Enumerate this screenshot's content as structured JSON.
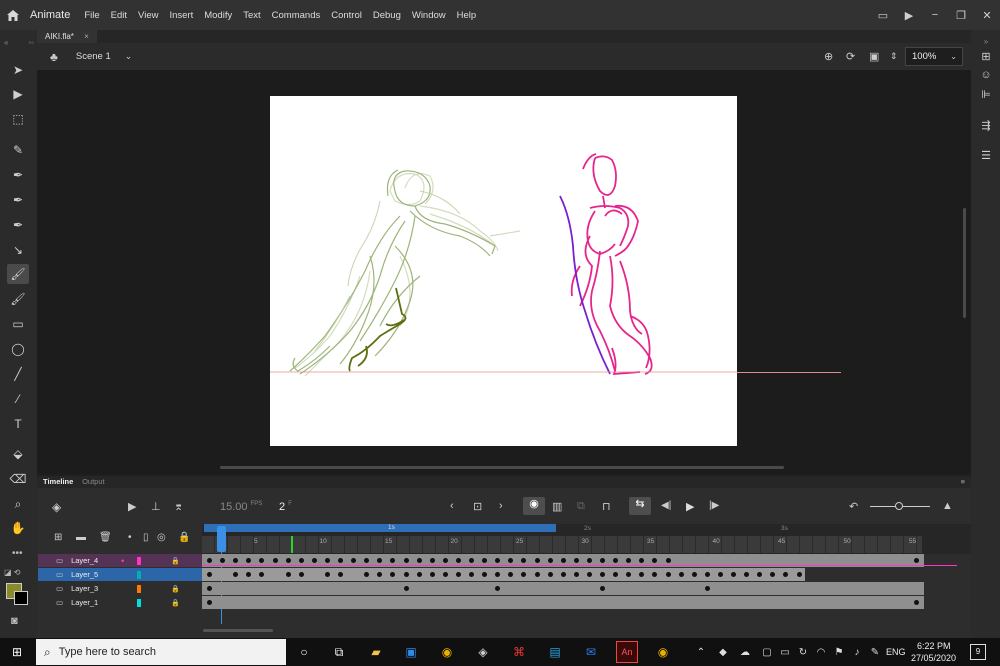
{
  "app": {
    "name": "Animate"
  },
  "menu": [
    "File",
    "Edit",
    "View",
    "Insert",
    "Modify",
    "Text",
    "Commands",
    "Control",
    "Debug",
    "Window",
    "Help"
  ],
  "document": {
    "tab_title": "AIKI.fla*",
    "close_glyph": "×"
  },
  "scene": {
    "name": "Scene 1",
    "zoom": "100%"
  },
  "tools": [
    {
      "name": "selection-tool-icon",
      "glyph": "➤"
    },
    {
      "name": "subselection-tool-icon",
      "glyph": "▶"
    },
    {
      "name": "free-transform-tool-icon",
      "glyph": "⬚"
    },
    {
      "name": "pencil-tool-icon",
      "glyph": "✎"
    },
    {
      "name": "pen-tool-icon",
      "glyph": "✒"
    },
    {
      "name": "add-anchor-tool-icon",
      "glyph": "✒"
    },
    {
      "name": "width-tool-icon",
      "glyph": "✒"
    },
    {
      "name": "line-subselect-icon",
      "glyph": "↘"
    },
    {
      "name": "brush-tool-icon",
      "glyph": "🖌",
      "active": true
    },
    {
      "name": "paint-brush-tool-icon",
      "glyph": "🖌"
    },
    {
      "name": "rectangle-tool-icon",
      "glyph": "▭"
    },
    {
      "name": "oval-tool-icon",
      "glyph": "◯"
    },
    {
      "name": "line-tool-icon",
      "glyph": "╱"
    },
    {
      "name": "eyedropper-tool-icon",
      "glyph": "⁄"
    },
    {
      "name": "text-tool-icon",
      "glyph": "T"
    },
    {
      "name": "paint-bucket-tool-icon",
      "glyph": "⬙"
    },
    {
      "name": "eraser-tool-icon",
      "glyph": "⌫"
    },
    {
      "name": "zoom-tool-icon",
      "glyph": "⌕"
    },
    {
      "name": "hand-tool-icon",
      "glyph": "✋"
    }
  ],
  "colors": {
    "stroke_swatch": "#8a8a2a",
    "fill_swatch": "#000000",
    "pink": "#e6268c",
    "purple": "#7a1fd1",
    "green": "#8aa84a",
    "dark_green": "#5a6a10",
    "onion": "#bcc8a0",
    "guide": "#e08c8c"
  },
  "timeline": {
    "tab_timeline": "Timeline",
    "tab_output": "Output",
    "fps": "15.00",
    "fps_unit": "FPS",
    "frame": "2",
    "frame_unit": "F",
    "seconds_labels": [
      "1s",
      "2s",
      "3s"
    ],
    "frame_numbers": [
      "5",
      "10",
      "15",
      "20",
      "25",
      "30",
      "35",
      "40",
      "45",
      "50",
      "55"
    ],
    "layers": [
      {
        "name": "Layer_4",
        "color": "#ff33cc",
        "locked": true,
        "selected": false,
        "dot": "•"
      },
      {
        "name": "Layer_5",
        "color": "#00b0b0",
        "locked": false,
        "selected": true,
        "dot": ""
      },
      {
        "name": "Layer_3",
        "color": "#ff7700",
        "locked": true,
        "selected": false,
        "dot": ""
      },
      {
        "name": "Layer_1",
        "color": "#00e0e0",
        "locked": true,
        "selected": false,
        "dot": ""
      }
    ]
  },
  "taskbar": {
    "search_placeholder": "Type here to search",
    "language": "ENG",
    "time": "6:22 PM",
    "date": "27/05/2020",
    "notifications": "9"
  }
}
